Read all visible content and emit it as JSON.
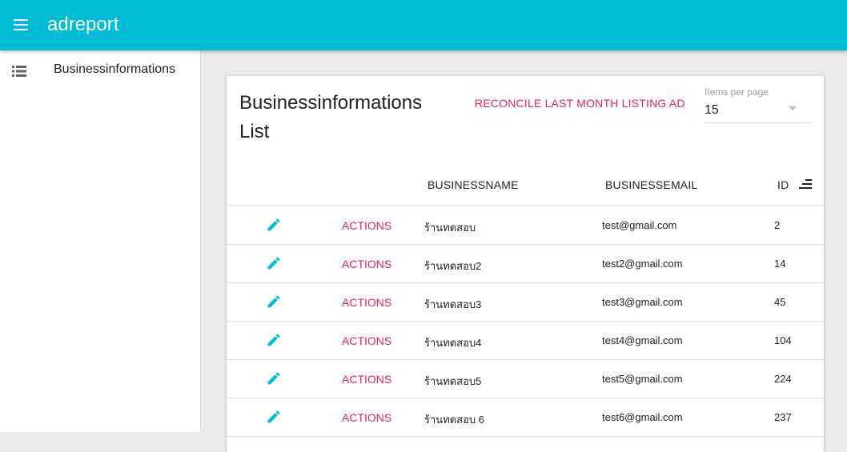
{
  "appbar": {
    "title": "adreport",
    "menu_icon": "menu-icon",
    "color": "#00bcd4"
  },
  "sidebar": {
    "items": [
      {
        "label": "Businessinformations",
        "icon": "list-icon"
      }
    ]
  },
  "card": {
    "title": "Businessinformations List",
    "reconcile_label": "RECONCILE LAST MONTH LISTING AD",
    "items_per_page": {
      "label": "Items per page",
      "value": "15"
    },
    "columns": {
      "businessname": "BUSINESSNAME",
      "businessemail": "BUSINESSEMAIL",
      "id": "ID"
    },
    "rows": [
      {
        "edit_icon": "pencil-icon",
        "actions": "ACTIONS",
        "businessname": "ร้านทดสอบ",
        "businessemail": "test@gmail.com",
        "id": "2"
      },
      {
        "edit_icon": "pencil-icon",
        "actions": "ACTIONS",
        "businessname": "ร้านทดสอบ2",
        "businessemail": "test2@gmail.com",
        "id": "14"
      },
      {
        "edit_icon": "pencil-icon",
        "actions": "ACTIONS",
        "businessname": "ร้านทดสอบ3",
        "businessemail": "test3@gmail.com",
        "id": "45"
      },
      {
        "edit_icon": "pencil-icon",
        "actions": "ACTIONS",
        "businessname": "ร้านทดสอบ4",
        "businessemail": "test4@gmail.com",
        "id": "104"
      },
      {
        "edit_icon": "pencil-icon",
        "actions": "ACTIONS",
        "businessname": "ร้านทดสอบ5",
        "businessemail": "test5@gmail.com",
        "id": "224"
      },
      {
        "edit_icon": "pencil-icon",
        "actions": "ACTIONS",
        "businessname": "ร้านทดสอบ 6",
        "businessemail": "test6@gmail.com",
        "id": "237"
      }
    ]
  },
  "colors": {
    "accent": "#e91e63",
    "primary": "#00bcd4",
    "icon": "#00bcd4"
  }
}
